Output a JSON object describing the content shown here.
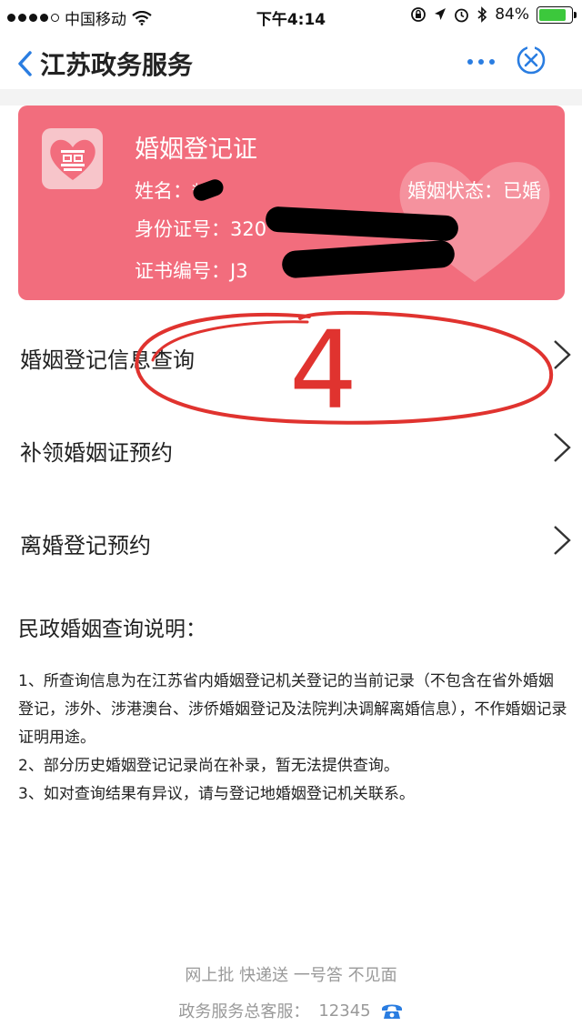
{
  "status_bar": {
    "carrier": "中国移动",
    "time": "下午4:14",
    "battery": "84%",
    "battery_level": 0.84
  },
  "nav": {
    "title": "江苏政务服务",
    "back_icon": "chevron-left-icon",
    "more_icon": "more-icon",
    "close_icon": "close-circle-icon"
  },
  "card": {
    "title": "婚姻登记证",
    "name_label": "姓名：",
    "name_value": "*",
    "status_label": "婚姻状态：",
    "status_value": "已婚",
    "id_label": "身份证号：",
    "id_value": "320",
    "cert_label": "证书编号：",
    "cert_value": "J3",
    "color": "#f26d7d"
  },
  "menu": [
    {
      "label": "婚姻登记信息查询"
    },
    {
      "label": "补领婚姻证预约"
    },
    {
      "label": "离婚登记预约"
    }
  ],
  "notes": {
    "title": "民政婚姻查询说明：",
    "items": [
      "1、所查询信息为在江苏省内婚姻登记机关登记的当前记录（不包含在省外婚姻登记，涉外、涉港澳台、涉侨婚姻登记及法院判决调解离婚信息），不作婚姻记录证明用途。",
      "2、部分历史婚姻登记记录尚在补录，暂无法提供查询。",
      "3、如对查询结果有异议，请与登记地婚姻登记机关联系。"
    ]
  },
  "annotation": {
    "text": "4",
    "color": "#e0332f"
  },
  "footer": {
    "slogan": "网上批 快递送 一号答 不见面",
    "hotline_label": "政务服务总客服：",
    "hotline_number": "12345"
  }
}
